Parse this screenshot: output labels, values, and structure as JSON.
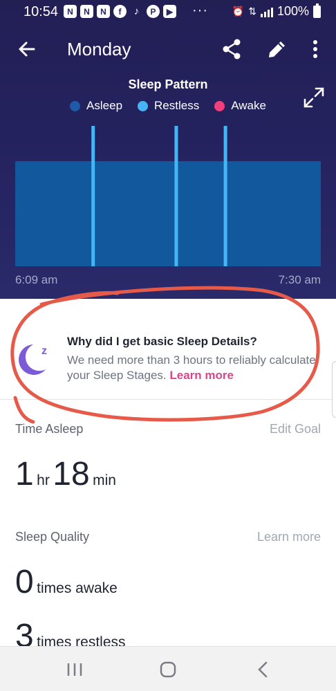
{
  "status_bar": {
    "time": "10:54",
    "battery": "100%",
    "apps": [
      "N",
      "N",
      "N",
      "f",
      "♪",
      "P",
      "▶"
    ],
    "overflow": "···"
  },
  "header": {
    "title": "Monday",
    "icons": [
      "back-arrow-icon",
      "share-icon",
      "pencil-icon",
      "more-vert-icon"
    ]
  },
  "chart_data": {
    "type": "bar",
    "title": "Sleep Pattern",
    "legend": [
      {
        "name": "Asleep",
        "color": "#1d5aa8"
      },
      {
        "name": "Restless",
        "color": "#45b6f5"
      },
      {
        "name": "Awake",
        "color": "#f03f7b"
      }
    ],
    "x_start": "6:09 am",
    "x_end": "7:30 am",
    "asleep_span": [
      0.0,
      1.0
    ],
    "restless_events": [
      0.255,
      0.527,
      0.688
    ],
    "awake_events": [],
    "colors": {
      "asleep": "#12589c",
      "restless": "#45b6f5",
      "awake": "#f03f7b"
    }
  },
  "info_card": {
    "title": "Why did I get basic Sleep Details?",
    "body": "We need more than 3 hours to reliably calculate your Sleep Stages.",
    "link": "Learn more"
  },
  "time_asleep": {
    "label": "Time Asleep",
    "action": "Edit Goal",
    "hours": "1",
    "hours_unit": "hr",
    "minutes": "18",
    "minutes_unit": "min"
  },
  "sleep_quality": {
    "label": "Sleep Quality",
    "action": "Learn more",
    "awake_count": "0",
    "awake_text": "times awake",
    "restless_count": "3",
    "restless_text": "times restless"
  }
}
